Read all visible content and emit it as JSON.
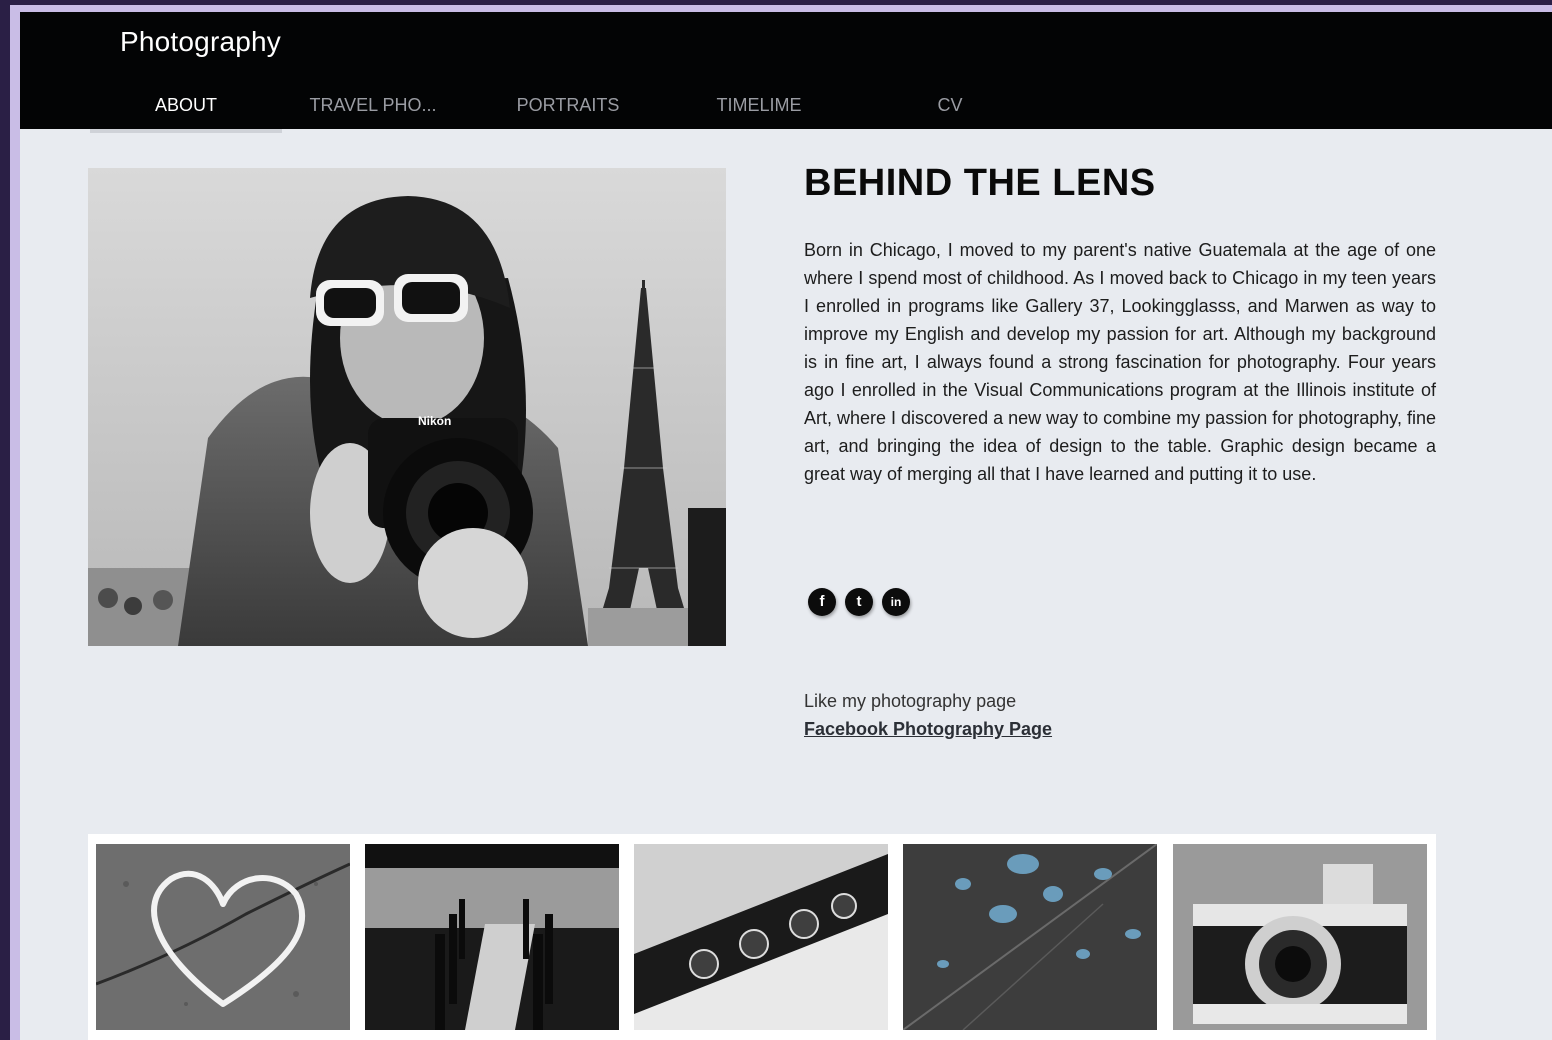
{
  "site": {
    "title": "Photography"
  },
  "nav": {
    "tabs": [
      {
        "label": "ABOUT",
        "active": true
      },
      {
        "label": "TRAVEL PHO...",
        "active": false
      },
      {
        "label": "PORTRAITS",
        "active": false
      },
      {
        "label": "TIMELIME",
        "active": false
      },
      {
        "label": "CV",
        "active": false
      }
    ]
  },
  "hero": {
    "image": "photographer-with-camera-eiffel-tower-bw"
  },
  "about": {
    "heading": "BEHIND THE LENS",
    "bio": "Born in Chicago, I moved to my parent's native Guatemala at the age of one where I spend most of childhood. As I moved back to Chicago in my teen years I enrolled in programs like Gallery 37, Lookingglasss, and Marwen as way to improve my English and develop my passion for art. Although my background is in fine art, I always found a strong fascination for photography. Four years ago I enrolled in the Visual Communications program at the Illinois institute of Art, where I discovered a new way to combine my passion for photography, fine art, and bringing the idea of design to the table. Graphic design became a great way of merging all that I have learned and putting it to use."
  },
  "social": {
    "facebook_glyph": "f",
    "twitter_glyph": "t",
    "linkedin_glyph": "in",
    "icons": [
      "facebook-icon",
      "twitter-icon",
      "linkedin-icon"
    ]
  },
  "promo": {
    "like_text": "Like my photography page",
    "link_text": "Facebook Photography Page"
  },
  "gallery": {
    "thumbnails": [
      "chalk-heart",
      "dock-on-lake",
      "clarinet-keys",
      "leaf-water-drops",
      "vintage-camera"
    ]
  },
  "colors": {
    "topbar": "#030405",
    "page_bg": "#e8ebf0",
    "nav_active": "#ffffff",
    "nav_inactive": "#9a9ca3",
    "accent_drops": "#6fa7c9"
  }
}
